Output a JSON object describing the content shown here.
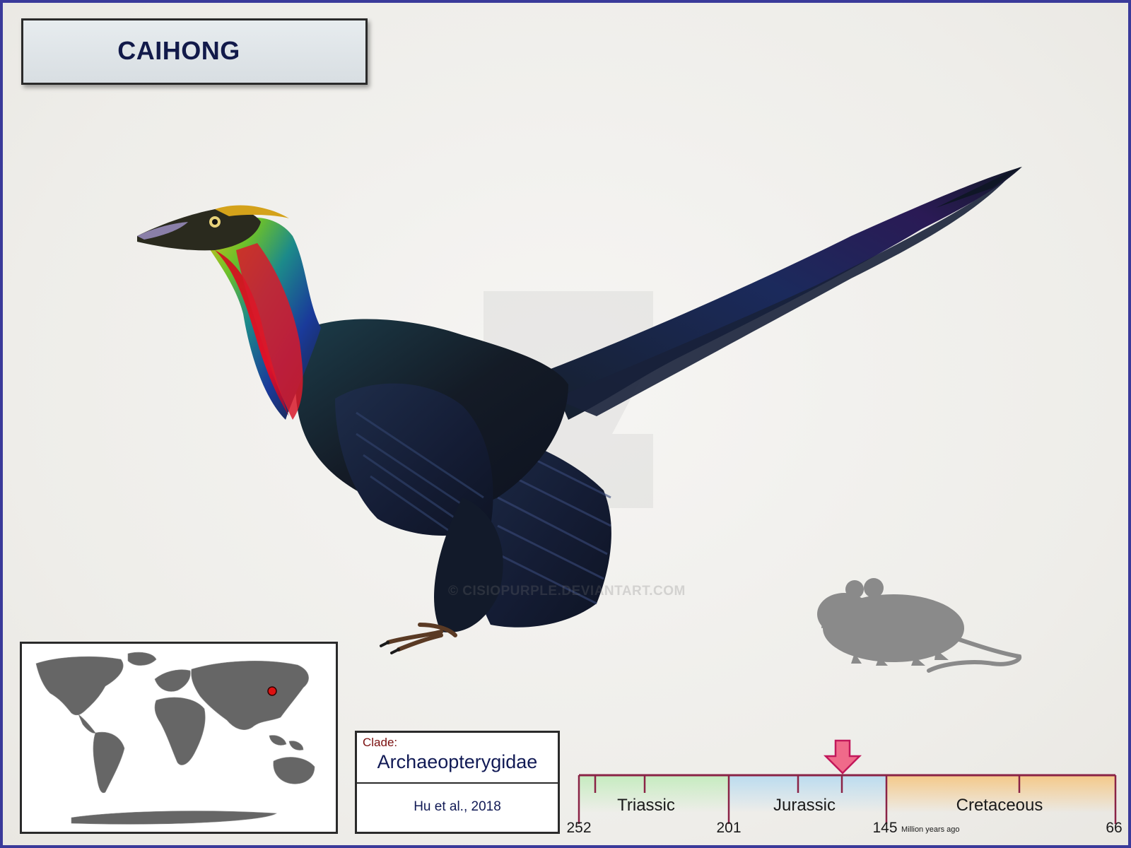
{
  "title": "CAIHONG",
  "watermark": "© CISIOPURPLE.DEVIANTART.COM",
  "map": {
    "locality_marker_color": "#dd1111"
  },
  "clade": {
    "label": "Clade:",
    "name": "Archaeopterygidae",
    "author": "Hu et al., 2018"
  },
  "timeline": {
    "periods": [
      {
        "name": "Triassic",
        "color": "#c6ecc0"
      },
      {
        "name": "Jurassic",
        "color": "#bcdcef"
      },
      {
        "name": "Cretaceous",
        "color": "#f4c98a"
      }
    ],
    "ticks": [
      {
        "label": "252"
      },
      {
        "label": "201"
      },
      {
        "label": "145"
      },
      {
        "label": "66"
      }
    ],
    "unit_label": "Million years ago",
    "marker_color": "#f06a8a"
  },
  "scale_silhouette": "mouse-silhouette"
}
